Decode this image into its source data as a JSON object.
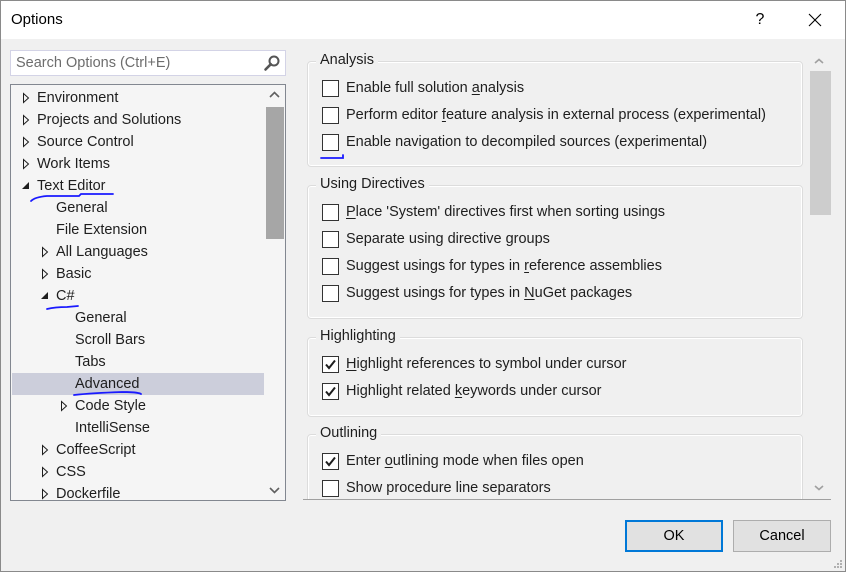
{
  "window": {
    "title": "Options",
    "help_label": "?",
    "close_icon": "close-icon"
  },
  "search": {
    "value": "",
    "placeholder": "Search Options (Ctrl+E)",
    "icon": "search-icon"
  },
  "tree": {
    "items": [
      {
        "label": "Environment",
        "level": 0,
        "state": "collapsed"
      },
      {
        "label": "Projects and Solutions",
        "level": 0,
        "state": "collapsed"
      },
      {
        "label": "Source Control",
        "level": 0,
        "state": "collapsed"
      },
      {
        "label": "Work Items",
        "level": 0,
        "state": "collapsed"
      },
      {
        "label": "Text Editor",
        "level": 0,
        "state": "expanded"
      },
      {
        "label": "General",
        "level": 1,
        "state": "leaf"
      },
      {
        "label": "File Extension",
        "level": 1,
        "state": "leaf"
      },
      {
        "label": "All Languages",
        "level": 1,
        "state": "collapsed"
      },
      {
        "label": "Basic",
        "level": 1,
        "state": "collapsed"
      },
      {
        "label": "C#",
        "level": 1,
        "state": "expanded"
      },
      {
        "label": "General",
        "level": 2,
        "state": "leaf"
      },
      {
        "label": "Scroll Bars",
        "level": 2,
        "state": "leaf"
      },
      {
        "label": "Tabs",
        "level": 2,
        "state": "leaf"
      },
      {
        "label": "Advanced",
        "level": 2,
        "state": "leaf",
        "selected": true
      },
      {
        "label": "Code Style",
        "level": 2,
        "state": "collapsed"
      },
      {
        "label": "IntelliSense",
        "level": 2,
        "state": "leaf"
      },
      {
        "label": "CoffeeScript",
        "level": 1,
        "state": "collapsed"
      },
      {
        "label": "CSS",
        "level": 1,
        "state": "collapsed"
      },
      {
        "label": "Dockerfile",
        "level": 1,
        "state": "collapsed"
      }
    ],
    "selected_label": "Advanced"
  },
  "groups": [
    {
      "title": "Analysis",
      "options": [
        {
          "pre": "Enable full solution ",
          "key": "a",
          "post": "nalysis",
          "checked": false
        },
        {
          "pre": "Perform editor ",
          "key": "f",
          "post": "eature analysis in external process (experimental)",
          "checked": false
        },
        {
          "pre": "Enable navigation to decompiled sources (experimental)",
          "key": "",
          "post": "",
          "checked": false
        }
      ]
    },
    {
      "title": "Using Directives",
      "options": [
        {
          "pre": "",
          "key": "P",
          "post": "lace 'System' directives first when sorting usings",
          "checked": false
        },
        {
          "pre": "Separate using directive groups",
          "key": "",
          "post": "",
          "checked": false
        },
        {
          "pre": "Suggest usings for types in ",
          "key": "r",
          "post": "eference assemblies",
          "checked": false
        },
        {
          "pre": "Suggest usings for types in ",
          "key": "N",
          "post": "uGet packages",
          "checked": false
        }
      ]
    },
    {
      "title": "Highlighting",
      "options": [
        {
          "pre": "",
          "key": "H",
          "post": "ighlight references to symbol under cursor",
          "checked": true
        },
        {
          "pre": "Highlight related ",
          "key": "k",
          "post": "eywords under cursor",
          "checked": true
        }
      ]
    },
    {
      "title": "Outlining",
      "options": [
        {
          "pre": "Enter ",
          "key": "o",
          "post": "utlining mode when files open",
          "checked": true
        },
        {
          "pre": "Show procedure line separators",
          "key": "",
          "post": "",
          "checked": false
        }
      ]
    }
  ],
  "buttons": {
    "ok": "OK",
    "cancel": "Cancel"
  },
  "colors": {
    "selection": "#cccedb",
    "annotation_ink": "#1a1aff",
    "default_button_border": "#0078d7"
  }
}
